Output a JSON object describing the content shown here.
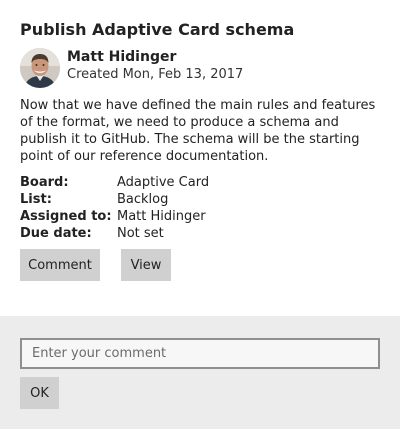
{
  "card": {
    "title": "Publish Adaptive Card schema",
    "author": {
      "name": "Matt Hidinger",
      "created": "Created Mon, Feb 13, 2017",
      "avatar_icon": "person-photo"
    },
    "description": "Now that we have defined the main rules and features of the format, we need to produce a schema and publish it to GitHub. The schema will be the starting point of our reference documentation.",
    "facts": [
      {
        "key": "Board:",
        "value": "Adaptive Card"
      },
      {
        "key": "List:",
        "value": "Backlog"
      },
      {
        "key": "Assigned to:",
        "value": "Matt Hidinger"
      },
      {
        "key": "Due date:",
        "value": "Not set"
      }
    ],
    "actions": {
      "comment_label": "Comment",
      "view_label": "View"
    }
  },
  "comment_panel": {
    "placeholder": "Enter your comment",
    "value": "",
    "ok_label": "OK"
  },
  "colors": {
    "button_bg": "#d0d0d0",
    "panel_bg": "#ececec",
    "input_border": "#8f8f8f"
  }
}
